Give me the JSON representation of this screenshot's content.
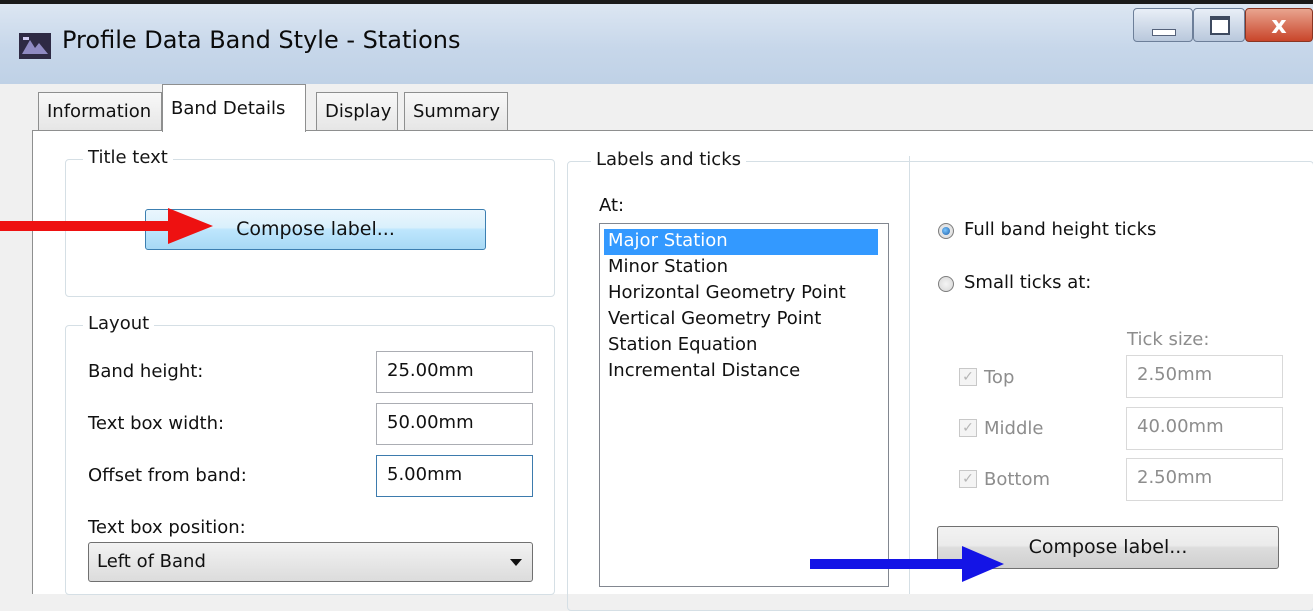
{
  "window": {
    "title": "Profile Data Band Style - Stations",
    "close_glyph": "x"
  },
  "tabs": [
    {
      "label": "Information"
    },
    {
      "label": "Band Details"
    },
    {
      "label": "Display"
    },
    {
      "label": "Summary"
    }
  ],
  "title_text": {
    "group_label": "Title text",
    "compose_button": "Compose label..."
  },
  "layout": {
    "group_label": "Layout",
    "band_height_label": "Band height:",
    "band_height_value": "25.00mm",
    "text_box_width_label": "Text box width:",
    "text_box_width_value": "50.00mm",
    "offset_label": "Offset from band:",
    "offset_value": "5.00mm",
    "text_box_position_label": "Text box position:",
    "text_box_position_value": "Left of Band"
  },
  "labels_ticks": {
    "group_label": "Labels and ticks",
    "at_label": "At:",
    "items": [
      "Major Station",
      "Minor Station",
      "Horizontal Geometry Point",
      "Vertical Geometry Point",
      "Station Equation",
      "Incremental Distance"
    ],
    "selected_index": 0,
    "full_band_label": "Full band height ticks",
    "small_ticks_label": "Small ticks at:",
    "tick_size_label": "Tick size:",
    "top_label": "Top",
    "top_value": "2.50mm",
    "middle_label": "Middle",
    "middle_value": "40.00mm",
    "bottom_label": "Bottom",
    "bottom_value": "2.50mm",
    "compose_button": "Compose label..."
  },
  "colors": {
    "red_arrow": "#ee1111",
    "blue_arrow": "#1414e6"
  }
}
